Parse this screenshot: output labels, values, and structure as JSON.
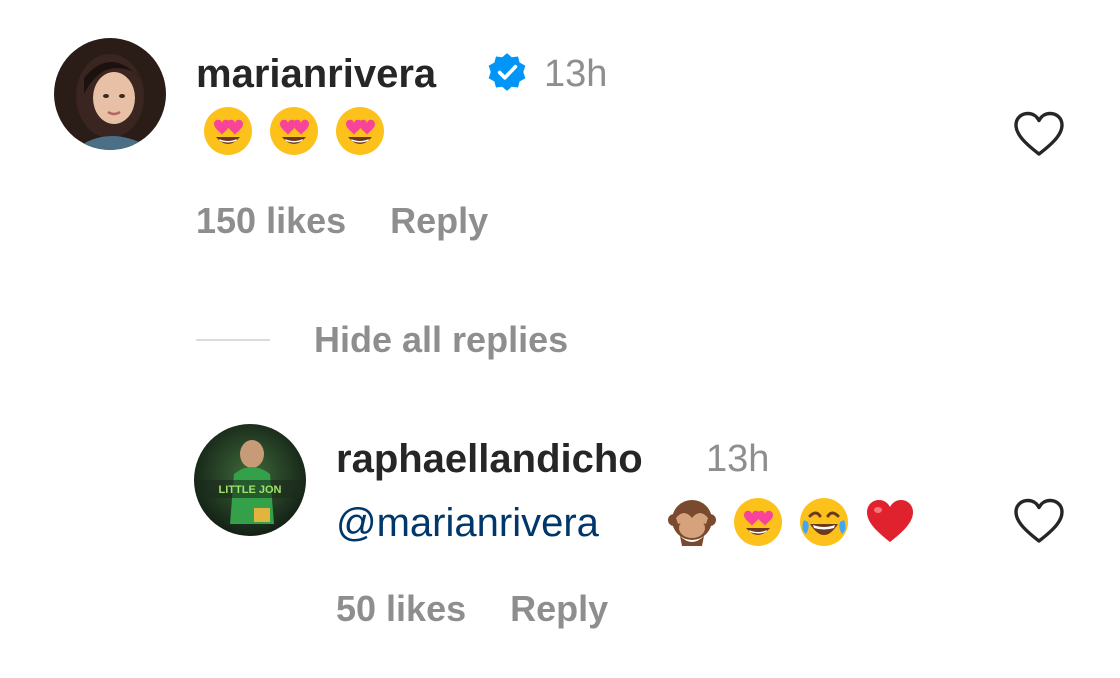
{
  "comment": {
    "username": "marianrivera",
    "verified": true,
    "time": "13h",
    "emojis": [
      "heart-eyes",
      "heart-eyes",
      "heart-eyes"
    ],
    "likes": "150 likes",
    "reply_label": "Reply"
  },
  "replies_toggle": "Hide all replies",
  "reply": {
    "username": "raphaellandicho",
    "time": "13h",
    "mention": "@marianrivera",
    "emojis": [
      "see-no-evil-monkey",
      "heart-eyes",
      "tears-of-joy",
      "red-heart"
    ],
    "likes": "50 likes",
    "reply_label": "Reply",
    "avatar_text": "LITTLE JON"
  },
  "colors": {
    "username": "#262626",
    "secondary": "#8e8e8e",
    "mention": "#00376b",
    "verified": "#0095f6",
    "divider": "#dbdbdb"
  }
}
